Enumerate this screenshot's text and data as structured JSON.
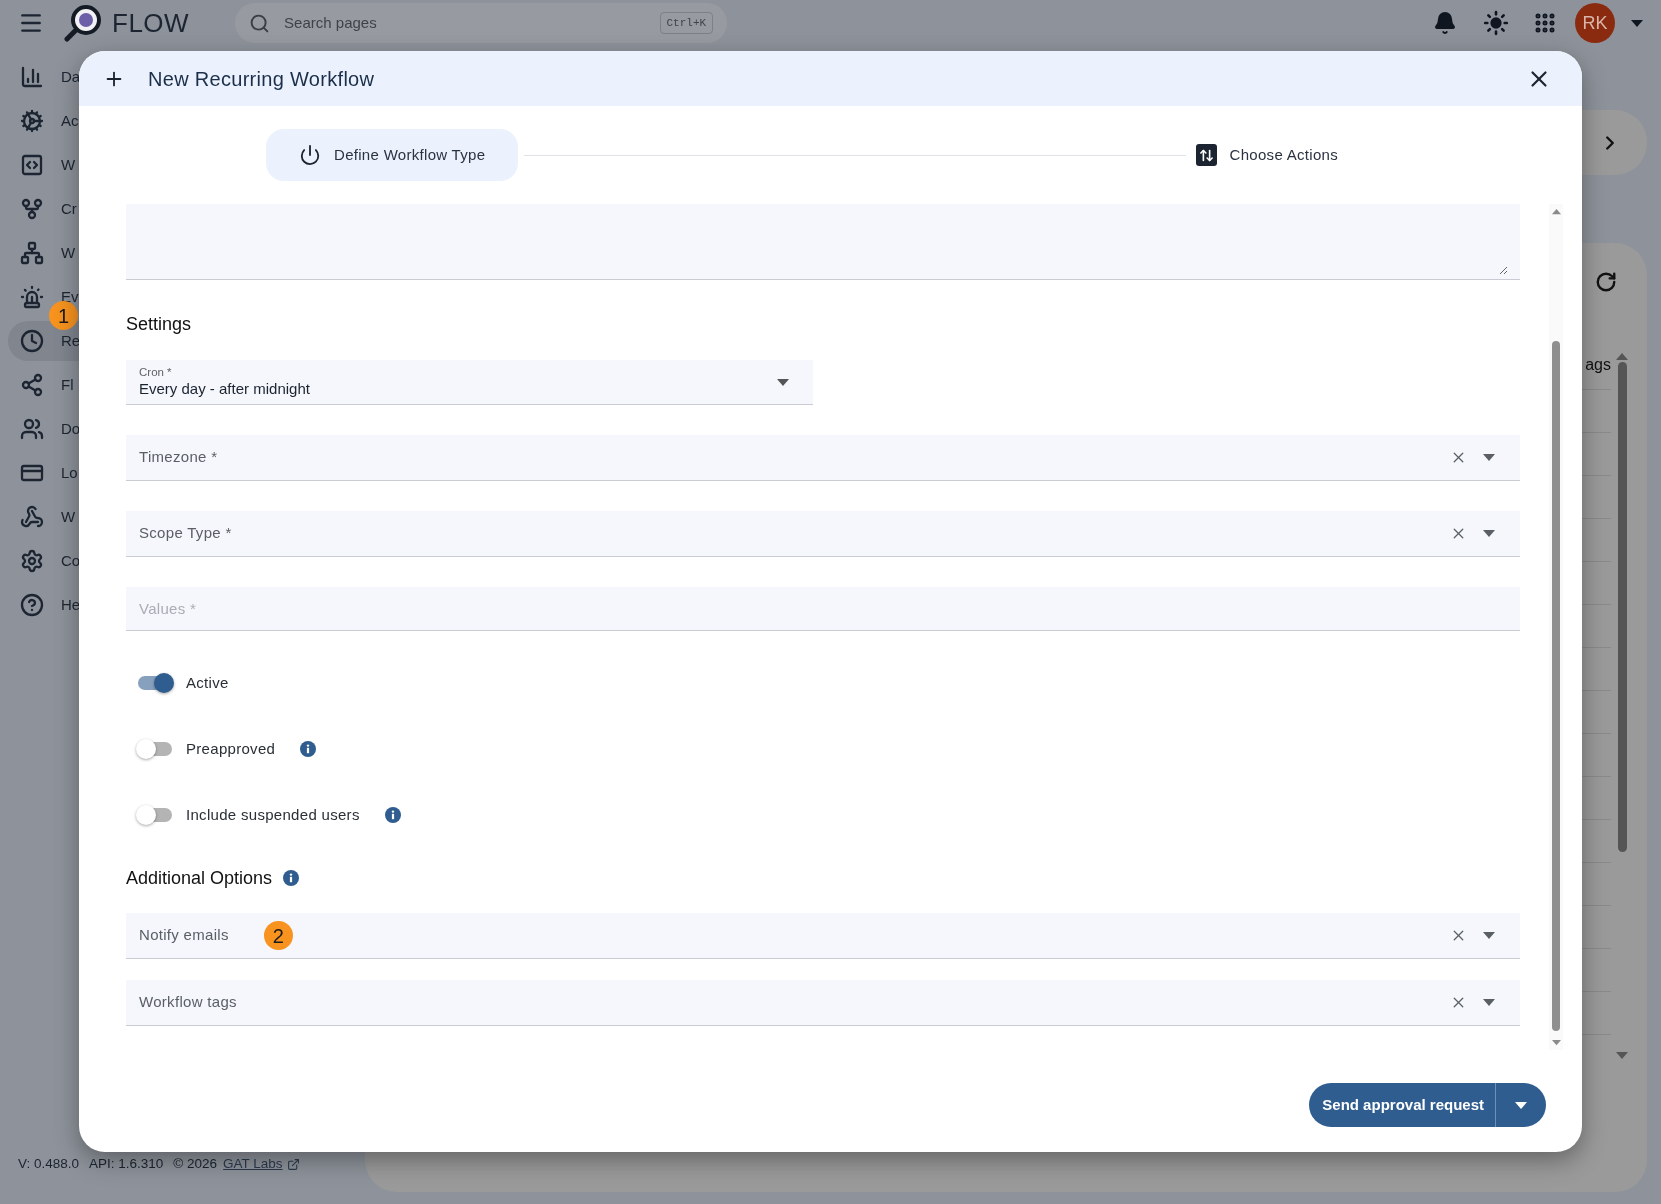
{
  "top_bar": {
    "logo_text": "FLOW",
    "search": {
      "placeholder": "Search pages",
      "shortcut": "Ctrl+K"
    },
    "avatar": "RK"
  },
  "sidebar": {
    "items": [
      {
        "label": "Da",
        "selected": false
      },
      {
        "label": "Ac",
        "selected": false
      },
      {
        "label": "W",
        "selected": false
      },
      {
        "label": "Cr",
        "selected": false
      },
      {
        "label": "W",
        "selected": false
      },
      {
        "label": "Ev",
        "selected": false
      },
      {
        "label": "Re",
        "selected": true,
        "badge": "1"
      },
      {
        "label": "Fl",
        "selected": false
      },
      {
        "label": "Do",
        "selected": false
      },
      {
        "label": "Lo",
        "selected": false
      },
      {
        "label": "W",
        "selected": false
      },
      {
        "label": "Co",
        "selected": false
      },
      {
        "label": "He",
        "selected": false
      }
    ]
  },
  "background": {
    "column_header": "ags"
  },
  "footer": {
    "version": "V: 0.488.0",
    "api": "API: 1.6.310",
    "copyright": "© 2026",
    "link": "GAT Labs"
  },
  "dialog": {
    "title": "New Recurring Workflow",
    "steps": [
      {
        "label": "Define Workflow Type",
        "selected": true
      },
      {
        "label": "Choose Actions",
        "selected": false
      }
    ],
    "settings_heading": "Settings",
    "fields": [
      {
        "kind": "select",
        "label": "Cron *",
        "value": "Every day - after midnight"
      },
      {
        "kind": "autocomplete",
        "label": "Timezone *"
      },
      {
        "kind": "autocomplete",
        "label": "Scope Type *"
      },
      {
        "kind": "text",
        "placeholder": "Values *"
      }
    ],
    "toggles": [
      {
        "label": "Active",
        "on": true,
        "info": false
      },
      {
        "label": "Preapproved",
        "on": false,
        "info": true
      },
      {
        "label": "Include suspended users",
        "on": false,
        "info": true
      }
    ],
    "additional_heading": "Additional Options",
    "additional_fields": [
      {
        "kind": "autocomplete",
        "label": "Notify emails",
        "badge": "2"
      },
      {
        "kind": "autocomplete",
        "label": "Workflow tags"
      }
    ],
    "submit_button": "Send approval request"
  }
}
